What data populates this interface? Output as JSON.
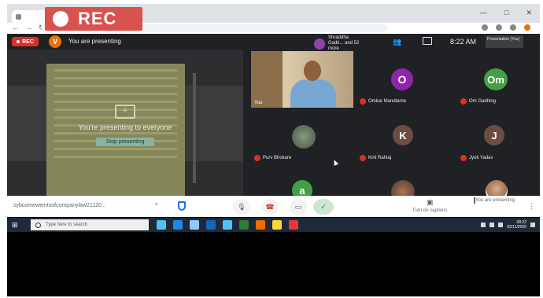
{
  "overlay": {
    "rec_label": "REC"
  },
  "window_controls": [
    "—",
    "□",
    "✕"
  ],
  "nav": [
    "←",
    "→",
    "↻"
  ],
  "meet_header": {
    "rec_badge": "REC",
    "avatar_letter": "V",
    "presenting_text": "You are presenting",
    "participants_summary": "Shraddha Gadk... and 52 more",
    "time": "8:22 AM",
    "presenter_thumb_label": "Presentation (You)"
  },
  "presentation": {
    "message": "You're presenting to everyone",
    "stop_button": "Stop presenting"
  },
  "participants": [
    {
      "type": "video",
      "name": "You"
    },
    {
      "type": "avatar",
      "letter": "O",
      "name": "Omkar Mandlarne",
      "color": "#8e24aa"
    },
    {
      "type": "avatar",
      "letter": "Om",
      "name": "Om Gadhing",
      "color": "#43a047"
    },
    {
      "type": "blurred",
      "name": "Purv Bhokare"
    },
    {
      "type": "avatar",
      "letter": "K",
      "name": "Kirti Rahtaj",
      "color": "#6d4c41"
    },
    {
      "type": "avatar",
      "letter": "J",
      "name": "Jyoti Yadav",
      "color": "#6d4c41"
    },
    {
      "type": "avatar",
      "letter": "a",
      "name": "",
      "color": "#43a047"
    },
    {
      "type": "photo",
      "name": ""
    },
    {
      "type": "photo",
      "name": ""
    }
  ],
  "meet_bar": {
    "url": "sybcomewtentsofcompanylaw21120...",
    "caret": "^",
    "mic_icon": "🎙",
    "end_icon": "☎",
    "video_icon": "▭",
    "check_icon": "✓",
    "captions_label": "Turn on captions",
    "presenting_label": "You are presenting",
    "kebab": "⋮"
  },
  "taskbar": {
    "start_glyph": "⊞",
    "search_placeholder": "Type here to search",
    "app_colors": [
      "#4fc3f7",
      "#1e88e5",
      "#90caf9",
      "#1565c0",
      "#4fc3f7",
      "#2e7d32",
      "#ef6c00",
      "#fdd835",
      "#e53935"
    ],
    "clock_time": "08:22",
    "clock_date": "02/11/2020"
  }
}
